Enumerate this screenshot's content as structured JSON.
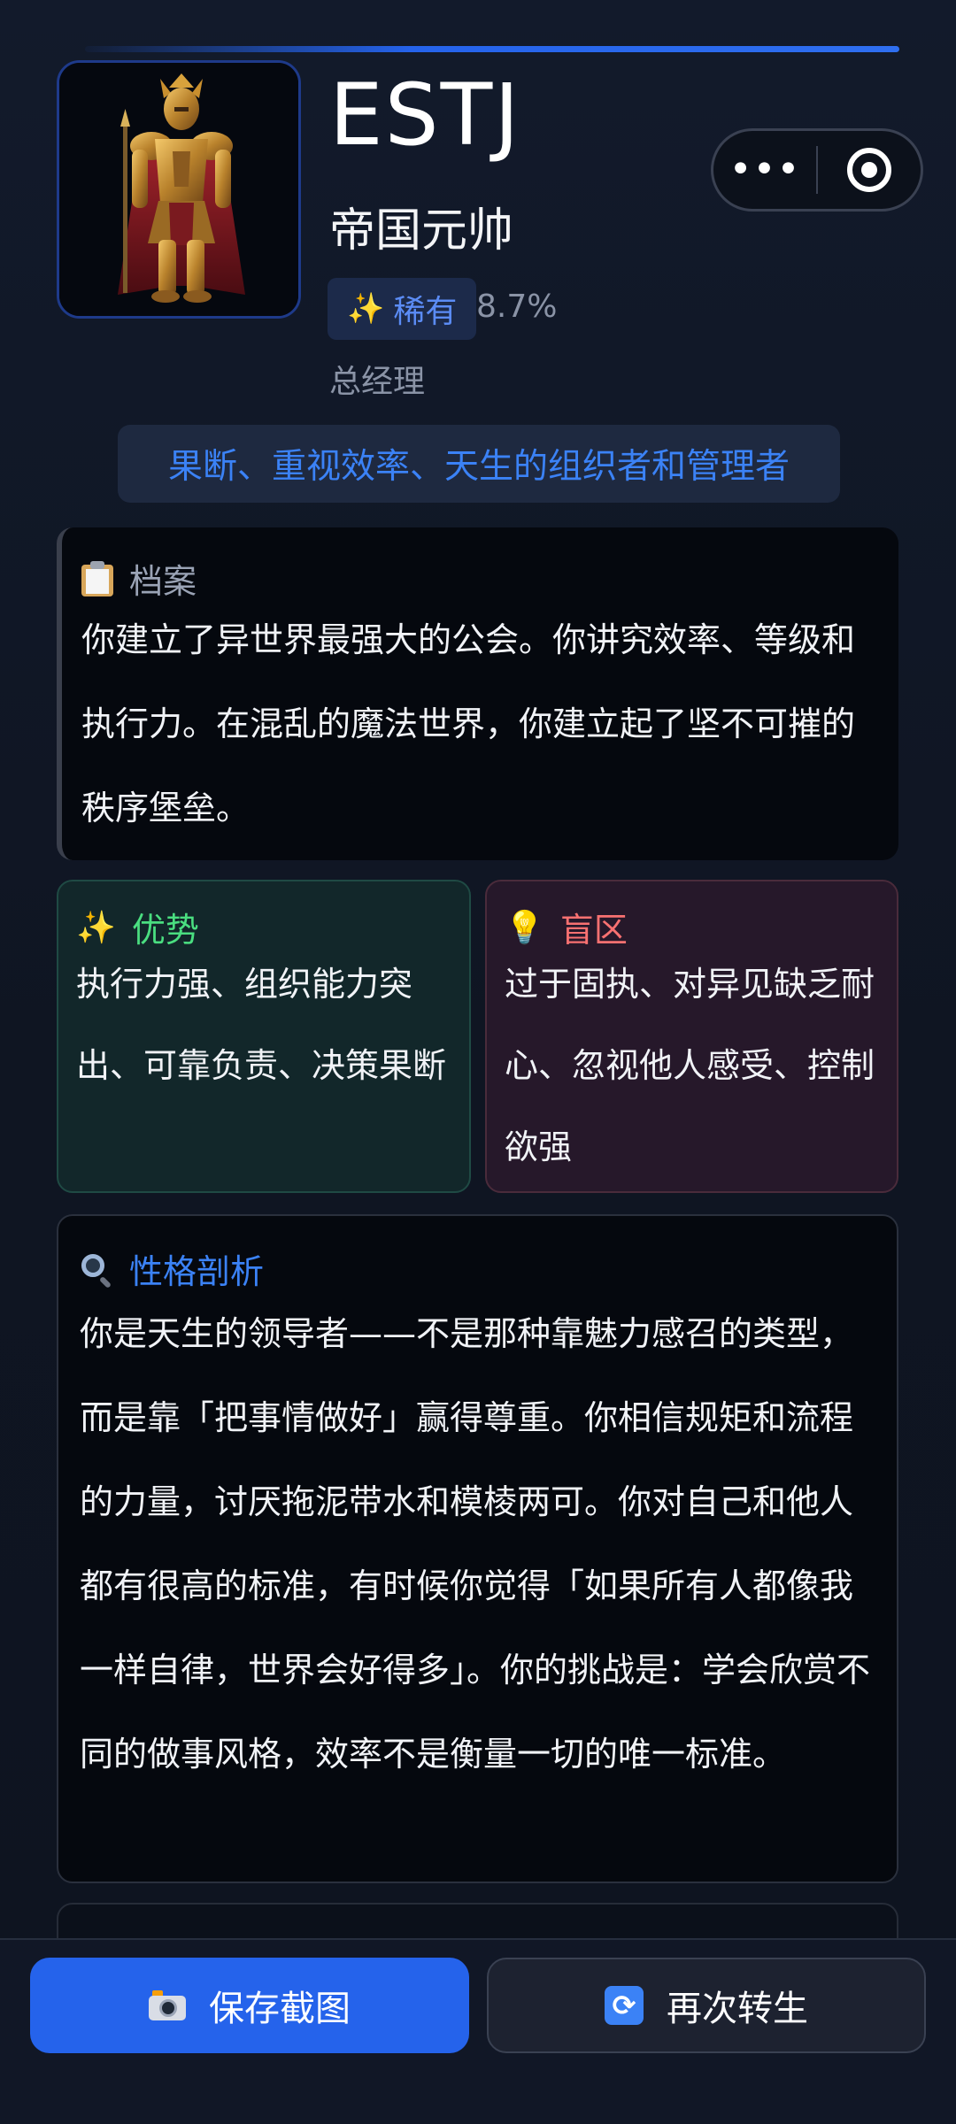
{
  "header": {
    "type_code": "ESTJ",
    "type_name": "帝国元帅",
    "rarity_label": "稀有",
    "rarity_percent": "8.7%",
    "role": "总经理"
  },
  "tagline": "果断、重视效率、天生的组织者和管理者",
  "profile": {
    "title": "档案",
    "body": "你建立了异世界最强大的公会。你讲究效率、等级和执行力。在混乱的魔法世界，你建立起了坚不可摧的秩序堡垒。"
  },
  "strengths": {
    "title": "优势",
    "body": "执行力强、组织能力突出、可靠负责、决策果断"
  },
  "blindspots": {
    "title": "盲区",
    "body": "过于固执、对异见缺乏耐心、忽视他人感受、控制欲强"
  },
  "analysis": {
    "title": "性格剖析",
    "body": "你是天生的领导者——不是那种靠魅力感召的类型，而是靠「把事情做好」赢得尊重。你相信规矩和流程的力量，讨厌拖泥带水和模棱两可。你对自己和他人都有很高的标准，有时候你觉得「如果所有人都像我一样自律，世界会好得多」。你的挑战是：学会欣赏不同的做事风格，效率不是衡量一切的唯一标准。"
  },
  "actions": {
    "save_label": "保存截图",
    "reroll_label": "再次转生"
  },
  "colors": {
    "accent": "#2563eb",
    "strength_title": "#4ade80",
    "blind_title": "#f87171",
    "analysis_title": "#3b82f6"
  },
  "icons": {
    "rarity": "sparkle-icon",
    "profile": "clipboard-icon",
    "strengths": "sparkle-icon",
    "blindspots": "lightbulb-icon",
    "analysis": "magnifier-icon",
    "save": "camera-icon",
    "reroll": "refresh-icon"
  }
}
